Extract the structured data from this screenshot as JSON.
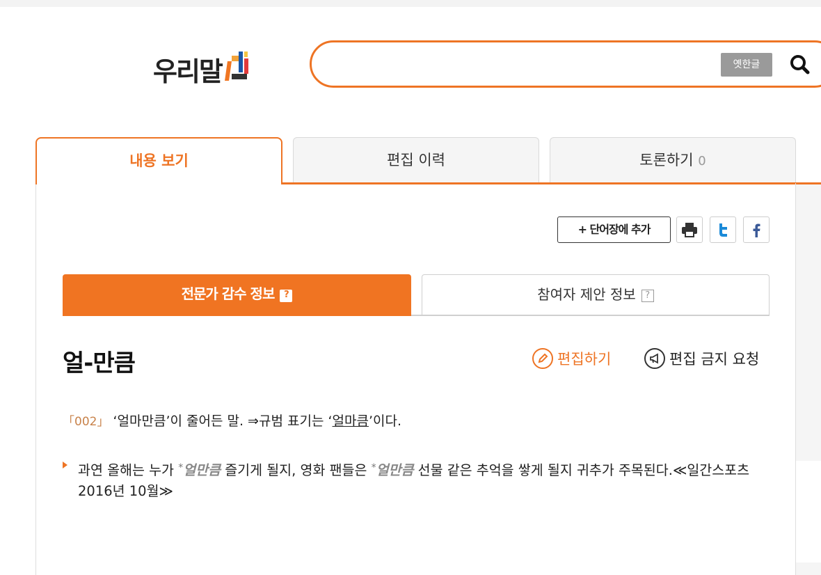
{
  "header": {
    "logo_text": "우리말샘",
    "search": {
      "value": "",
      "old_hangul_button": "옛한글"
    }
  },
  "tabs": [
    {
      "label": "내용 보기",
      "active": true
    },
    {
      "label": "편집 이력",
      "active": false
    },
    {
      "label": "토론하기",
      "count": "0",
      "active": false
    }
  ],
  "actions": {
    "add_to_wordbook": "단어장에 추가"
  },
  "subtabs": {
    "expert": "전문가 감수 정보",
    "participant": "참여자 제안 정보"
  },
  "entry": {
    "headword": "얼-만큼",
    "edit_label": "편집하기",
    "ban_label": "편집 금지 요청",
    "sense_number": "「002」",
    "definition_prefix": "‘얼마만큼’이 줄어든 말. ⇒규범 표기는 ‘",
    "definition_ref": "얼마큼",
    "definition_suffix": "’이다.",
    "example": {
      "part1": "과연 올해는 누가 ",
      "star1": "*",
      "word1": "얼만큼",
      "part2": " 즐기게 될지, 영화 팬들은 ",
      "star2": "*",
      "word2": "얼만큼",
      "part3": " 선물 같은 추억을 쌓게 될지 귀추가 주목된다.≪일간스포츠 2016년 10월≫"
    }
  },
  "colors": {
    "accent": "#ee7424"
  }
}
